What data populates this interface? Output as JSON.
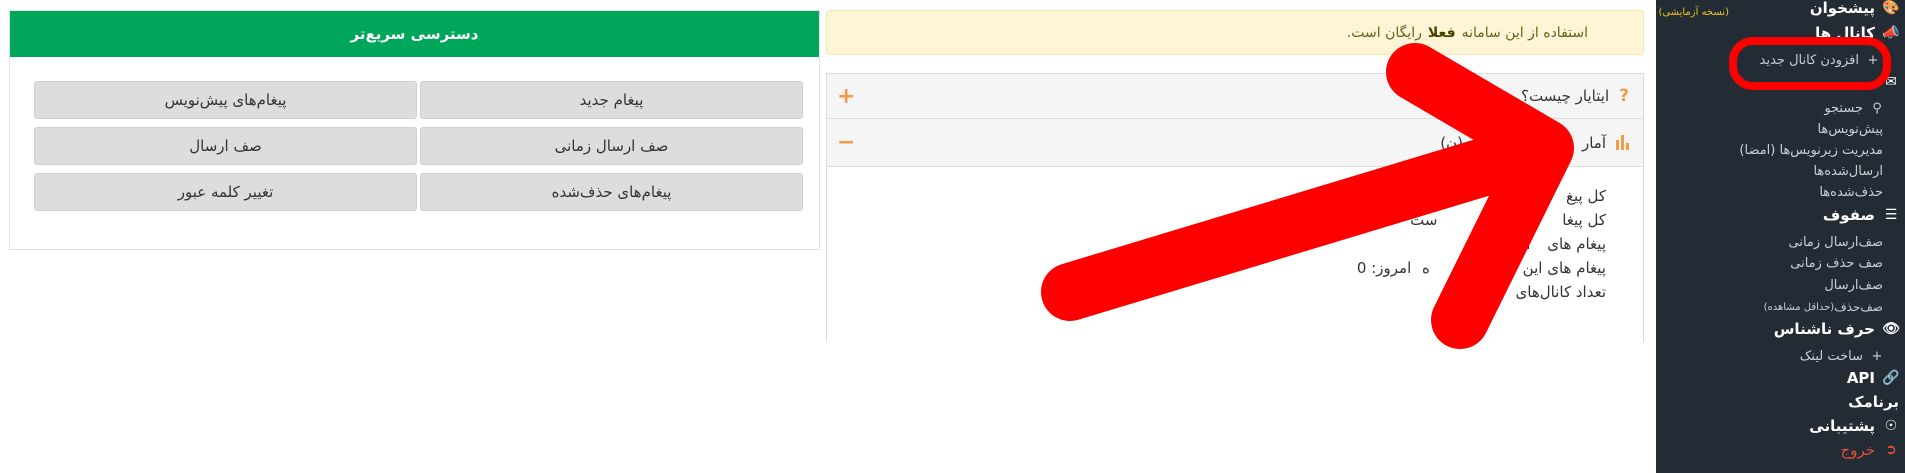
{
  "sidebar": {
    "demo_badge": "(نسخه آزمایشی)",
    "dashboard": "پیشخوان",
    "channels": "کانال ها",
    "add_channel": "افزودن کانال جدید",
    "search": "جستجو",
    "drafts": "پیش‌نویس‌ها",
    "signatures": "مدیریت زیرنویس‌ها (امضا)",
    "sent": "ارسال‌شده‌ها",
    "deleted": "حذف‌شده‌ها",
    "queues": "صفوف",
    "scheduled_queue": "صف‌ارسال زمانی",
    "timed_delete_queue": "صف حذف زمانی",
    "send_queue": "صف‌ارسال",
    "delete_queue": "صف‌حذف",
    "delete_queue_note": "(حداقل مشاهده)",
    "unknown_letter": "حرف ناشناس",
    "create_link": "ساخت لینک",
    "api": "API",
    "app": "برنامک",
    "support": "پشتیبانی",
    "logout": "خروج"
  },
  "alert": {
    "text_before": "استفاده از این سامانه",
    "highlight": "فعلا",
    "text_after": "رایگان است."
  },
  "accordion": {
    "faq_title": "ایتایار چیست؟",
    "stats_title": "آمار",
    "stats_title_tail": "(ن)",
    "stats": [
      "کل پیغ",
      "کل پیغا",
      "پیغام های",
      "پیغام های این",
      "تعداد کانال‌های"
    ],
    "stats_values": [
      "",
      "",
      "امروز: 0",
      "امروز: 0",
      ""
    ],
    "stats_mid": [
      "",
      "ست",
      "",
      "ه",
      ""
    ]
  },
  "quick_access": {
    "title": "دسترسی سریع‌تر",
    "buttons": [
      "پیغام جدید",
      "پیغام‌های پیش‌نویس",
      "صف ارسال زمانی",
      "صف ارسال",
      "پیغام‌های حذف‌شده",
      "تغییر کلمه عبور"
    ]
  },
  "colors": {
    "sidebar_bg": "#232c35",
    "accent_green": "#00a65a",
    "accent_orange": "#f39c45",
    "alert_bg": "#fdf5d5",
    "annotation_red": "#ff0000"
  }
}
